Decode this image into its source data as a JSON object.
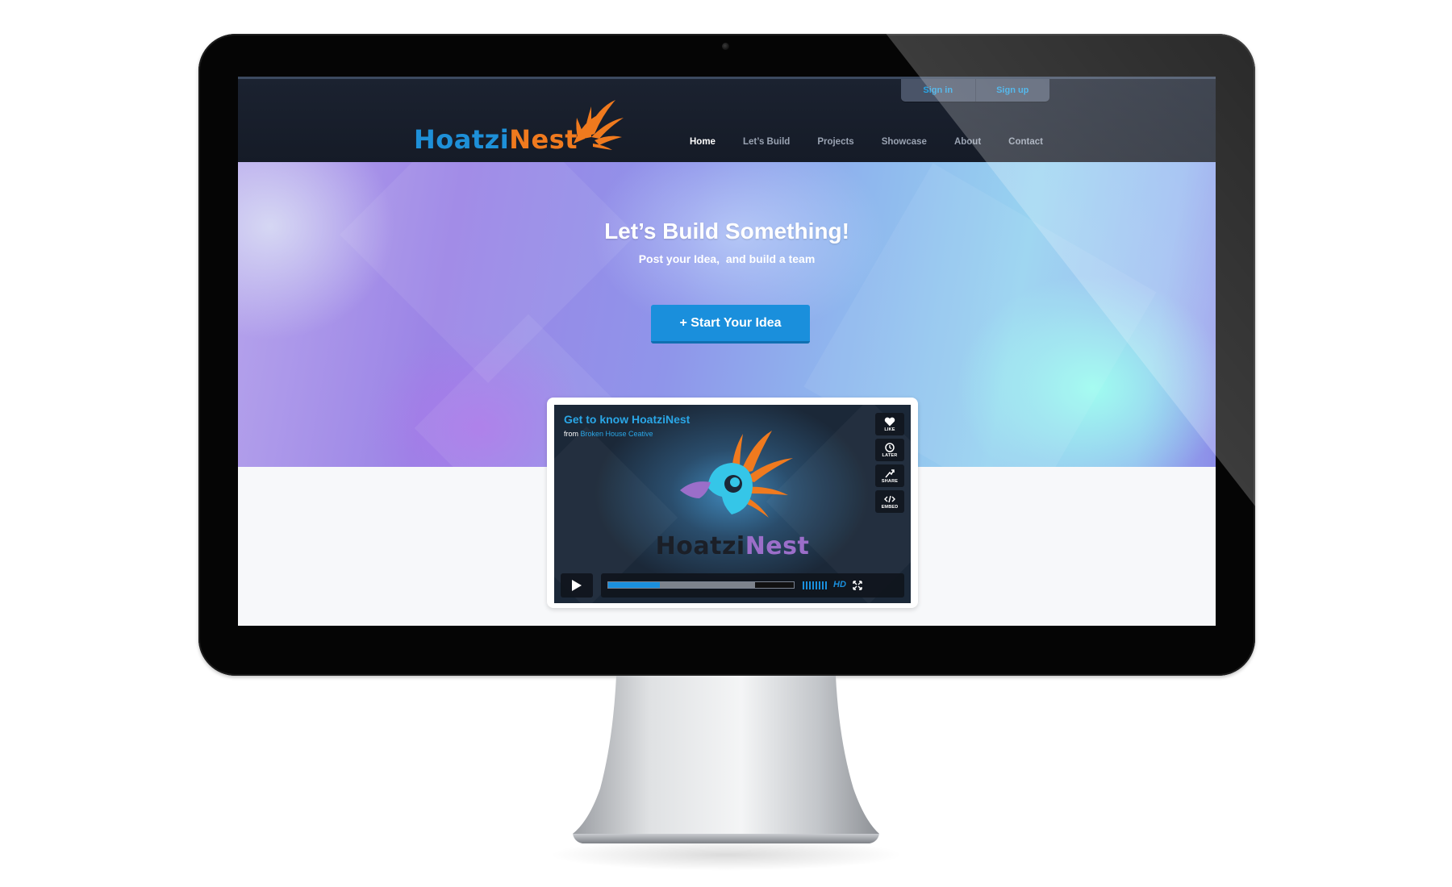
{
  "auth": {
    "sign_in": "Sign in",
    "sign_up": "Sign up"
  },
  "logo": {
    "part1": "Hoatzi",
    "part2": "Nest"
  },
  "nav": {
    "items": [
      {
        "label": "Home",
        "active": true
      },
      {
        "label": "Let’s Build"
      },
      {
        "label": "Projects"
      },
      {
        "label": "Showcase"
      },
      {
        "label": "About"
      },
      {
        "label": "Contact"
      }
    ]
  },
  "hero": {
    "title": "Let’s Build Something!",
    "subtitle": "Post your Idea,  and build a team",
    "cta": "+ Start Your Idea"
  },
  "video": {
    "title": "Get to know HoatziNest",
    "from_label": "from",
    "from_link": "Broken House Ceative",
    "side_buttons": [
      {
        "label": "LIKE",
        "icon": "heart-icon"
      },
      {
        "label": "LATER",
        "icon": "clock-icon"
      },
      {
        "label": "SHARE",
        "icon": "share-icon"
      },
      {
        "label": "EMBED",
        "icon": "embed-icon"
      }
    ],
    "brand_part1": "Hoatzi",
    "brand_part2": "Nest",
    "progress_played": 0.28,
    "progress_buffered": 0.79,
    "hd_label": "HD"
  },
  "colors": {
    "accent_blue": "#1a8fdc",
    "logo_orange": "#f07a1e",
    "header_bg": "#1b2230"
  }
}
